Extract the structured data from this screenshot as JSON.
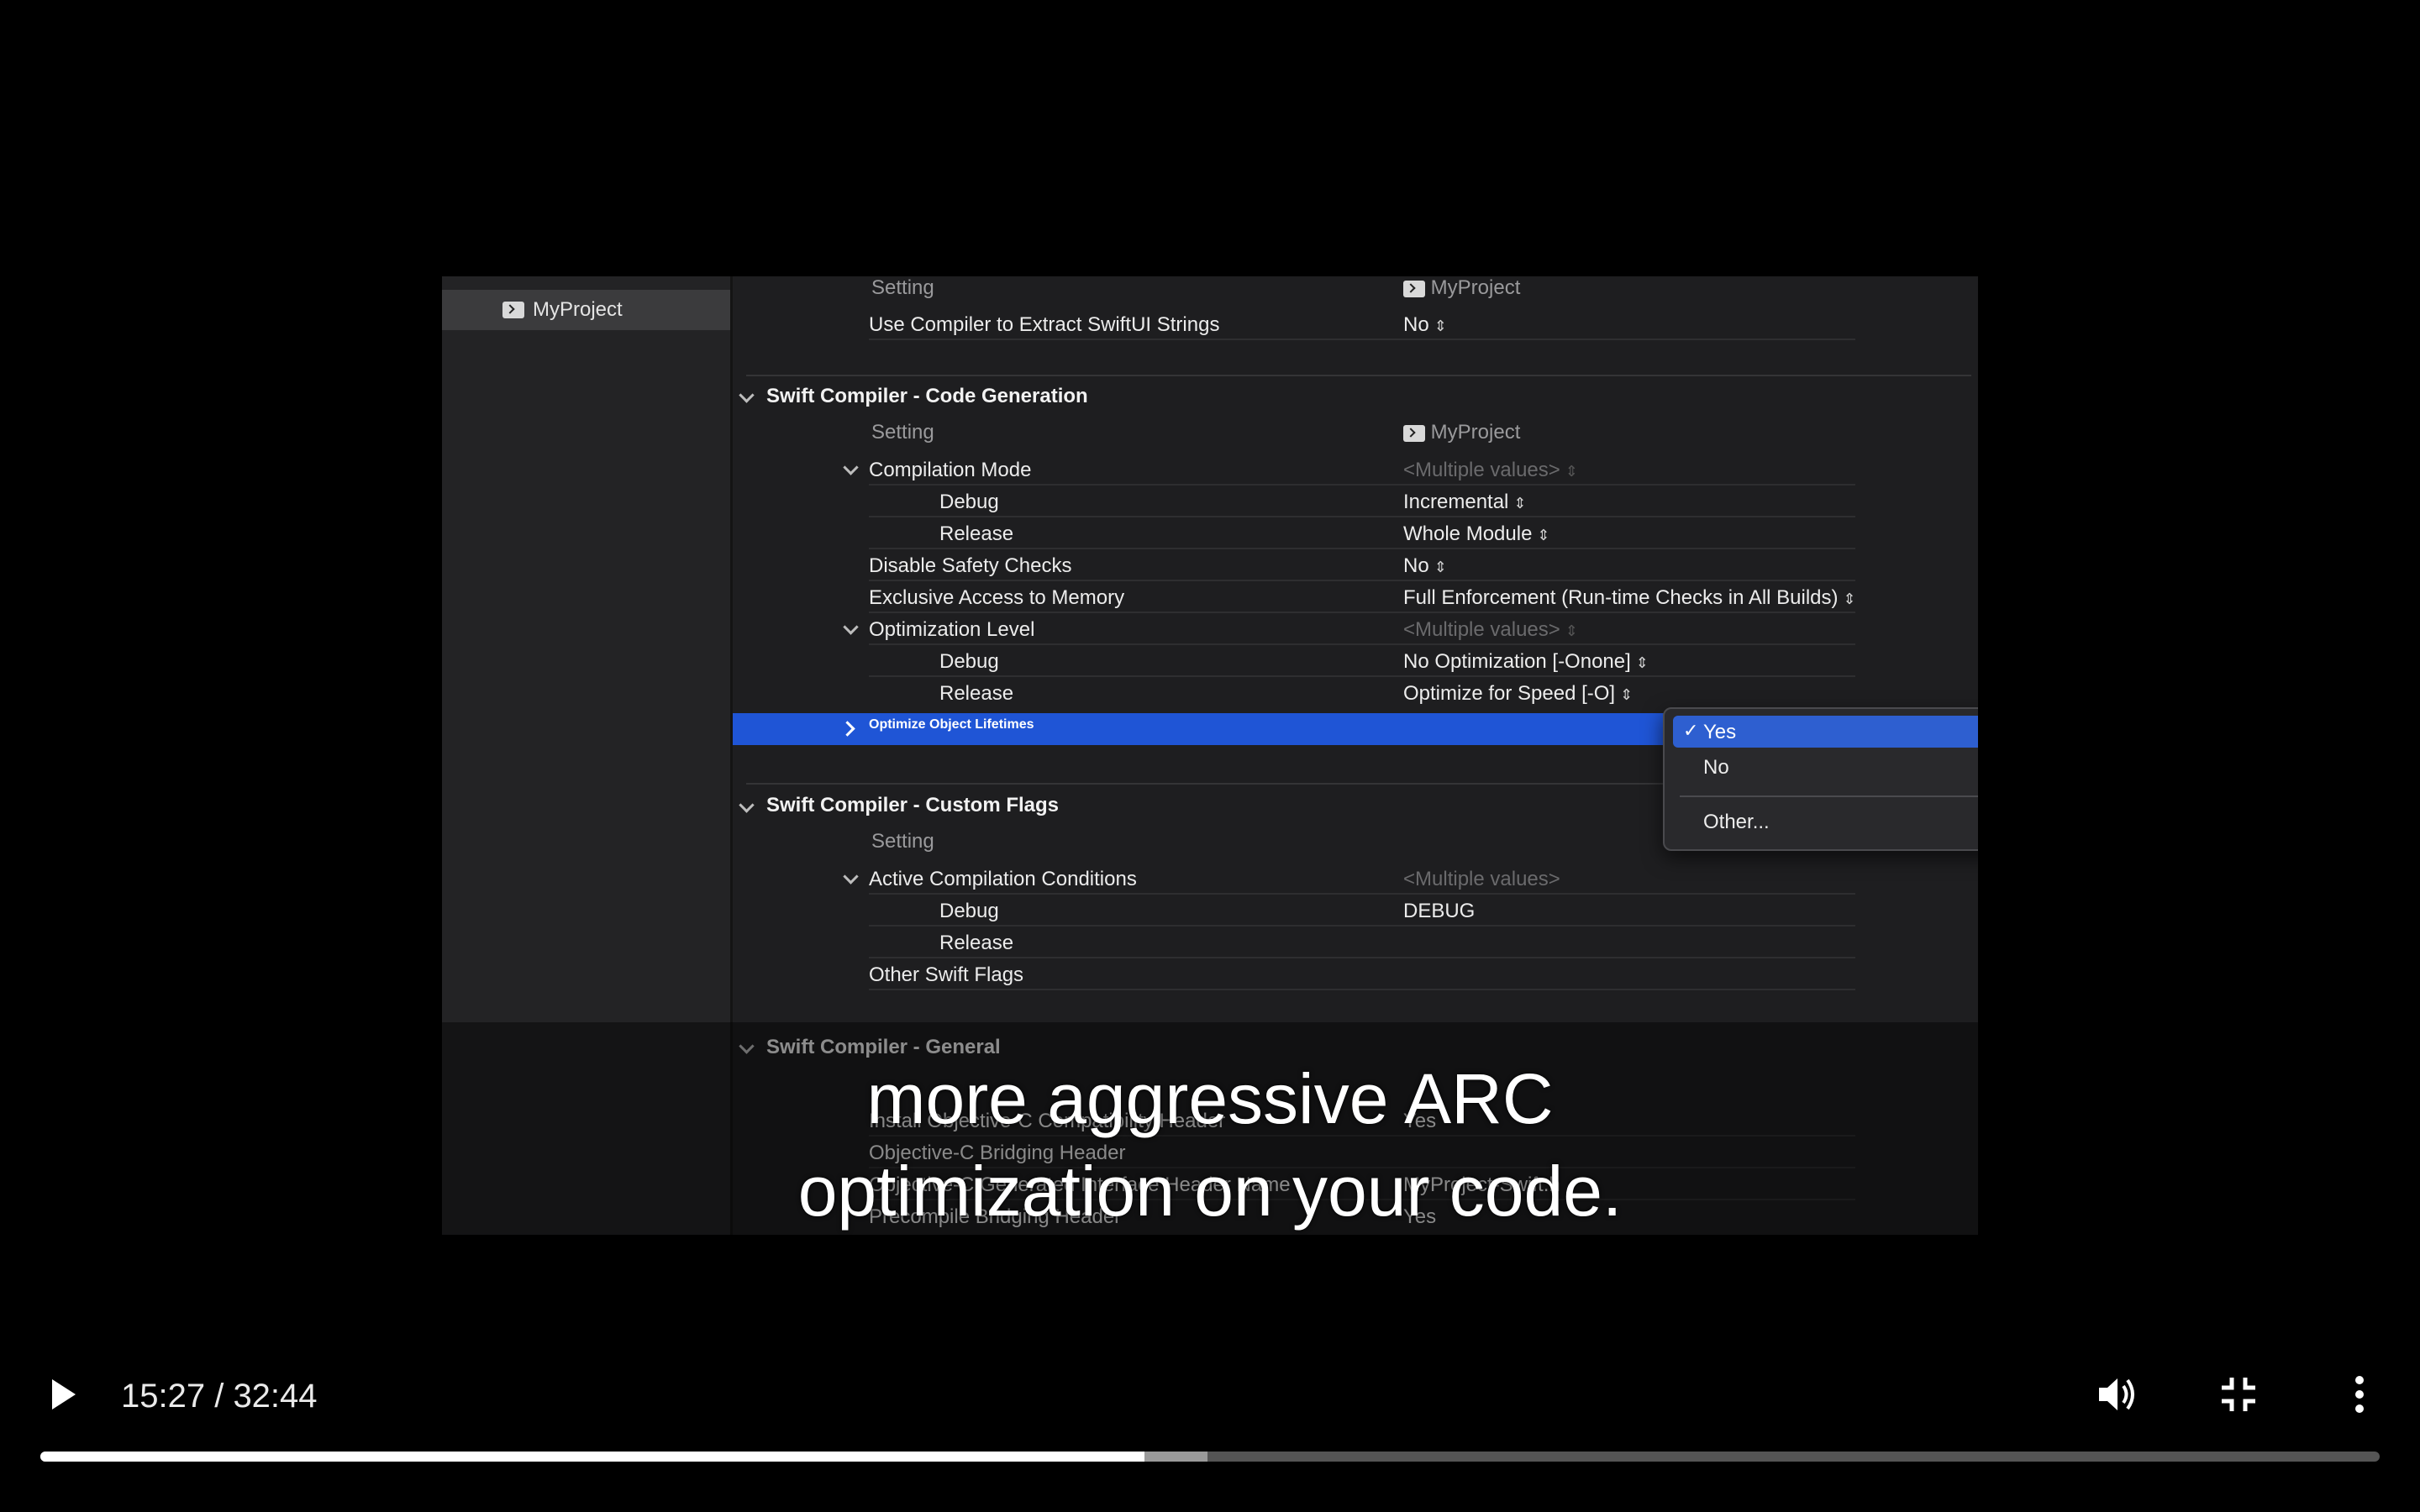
{
  "sidebar": {
    "project_label": "MyProject"
  },
  "settings": {
    "top": {
      "setting_header": "Setting",
      "project_header": "MyProject",
      "rows": [
        {
          "name": "Use Compiler to Extract SwiftUI Strings",
          "value": "No"
        }
      ]
    },
    "code_generation": {
      "title": "Swift Compiler - Code Generation",
      "setting_header": "Setting",
      "project_header": "MyProject",
      "compilation_mode": {
        "name": "Compilation Mode",
        "value": "<Multiple values>"
      },
      "compilation_debug": {
        "name": "Debug",
        "value": "Incremental"
      },
      "compilation_release": {
        "name": "Release",
        "value": "Whole Module"
      },
      "disable_safety": {
        "name": "Disable Safety Checks",
        "value": "No"
      },
      "exclusive_access": {
        "name": "Exclusive Access to Memory",
        "value": "Full Enforcement (Run-time Checks in All Builds)"
      },
      "optimization_level": {
        "name": "Optimization Level",
        "value": "<Multiple values>"
      },
      "optimization_debug": {
        "name": "Debug",
        "value": "No Optimization [-Onone]"
      },
      "optimization_release": {
        "name": "Release",
        "value": "Optimize for Speed [-O]"
      },
      "optimize_lifetimes": {
        "name": "Optimize Object Lifetimes"
      }
    },
    "custom_flags": {
      "title": "Swift Compiler - Custom Flags",
      "setting_header": "Setting",
      "active_conditions": {
        "name": "Active Compilation Conditions",
        "value": "<Multiple values>"
      },
      "conditions_debug": {
        "name": "Debug",
        "value": "DEBUG"
      },
      "conditions_release": {
        "name": "Release",
        "value": ""
      },
      "other_flags": {
        "name": "Other Swift Flags",
        "value": ""
      }
    },
    "general": {
      "title": "Swift Compiler - General",
      "rows": [
        {
          "name": "Install Objective-C Compatibility Header",
          "value": "Yes"
        },
        {
          "name": "Objective-C Bridging Header",
          "value": ""
        },
        {
          "name": "Objective-C Generated Interface Header Name",
          "value": "MyProject-Swift.h"
        },
        {
          "name": "Precompile Bridging Header",
          "value": "Yes"
        }
      ]
    }
  },
  "menu": {
    "items": [
      "Yes",
      "No",
      "Other..."
    ],
    "selected": "Yes",
    "check_glyph": "✓"
  },
  "caption": {
    "line1": "more aggressive ARC",
    "line2": "optimization on your code."
  },
  "player": {
    "time": "15:27 / 32:44",
    "played_fraction": 0.472,
    "buffered_fraction": 0.4988,
    "icons": [
      "play-icon",
      "volume-icon",
      "exit-fullscreen-icon",
      "more-options-icon"
    ]
  },
  "colors": {
    "selection": "#1f55d6",
    "menu_highlight": "#2e5fd0",
    "background": "#000000"
  }
}
